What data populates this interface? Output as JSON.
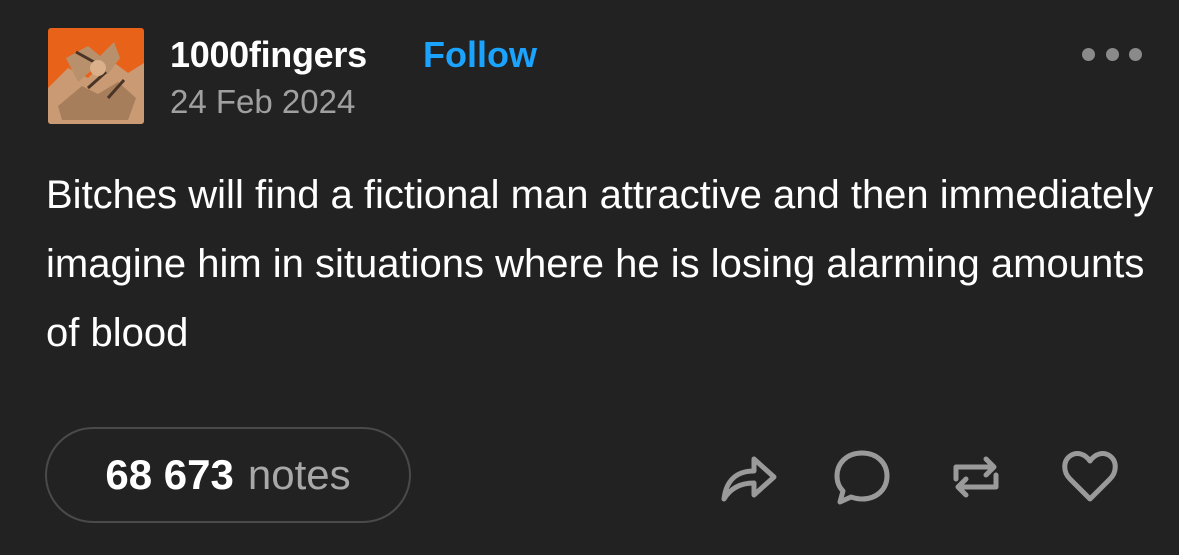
{
  "post": {
    "author": "1000fingers",
    "follow_label": "Follow",
    "date": "24 Feb 2024",
    "text": "Bitches will find a fictional man attractive and then immediately imagine him in situations where he is losing alarming amounts of blood"
  },
  "footer": {
    "notes_count": "68 673",
    "notes_label": "notes"
  },
  "icons": {
    "avatar": "avatar-illustration",
    "menu": "more-options-icon",
    "share": "share-icon",
    "reply": "reply-icon",
    "reblog": "reblog-icon",
    "like": "heart-icon"
  },
  "colors": {
    "background": "#222222",
    "text": "#ffffff",
    "muted": "#a0a0a0",
    "accent": "#1aa3ff",
    "avatar_orange": "#e8621a"
  }
}
